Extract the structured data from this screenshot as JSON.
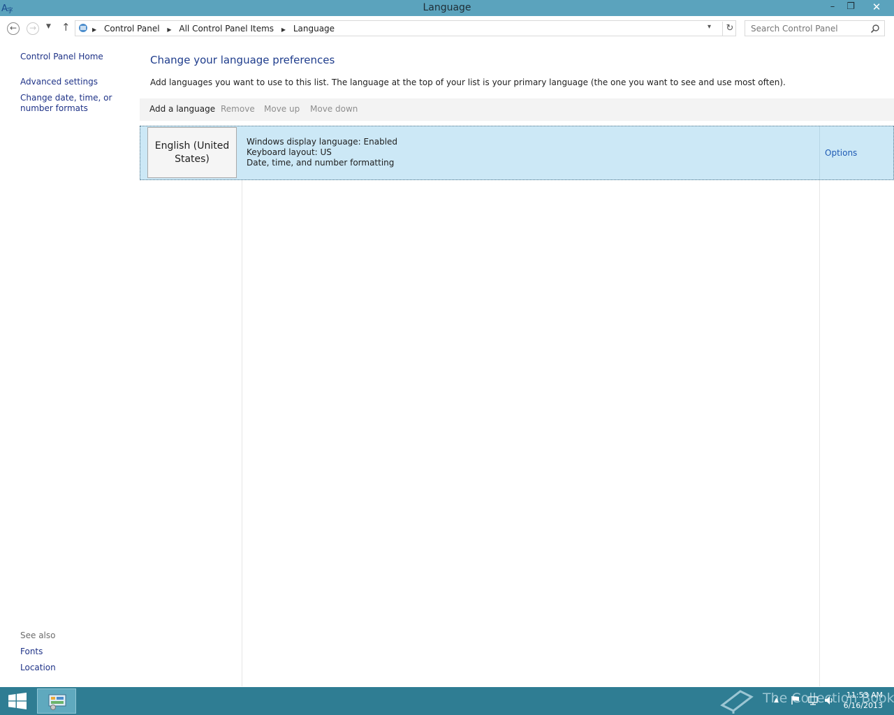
{
  "window": {
    "title": "Language",
    "minimize_glyph": "–",
    "restore_glyph": "❐",
    "close_glyph": "✕"
  },
  "nav": {
    "back_glyph": "←",
    "forward_glyph": "→",
    "recent_glyph": "▼",
    "up_glyph": "↑",
    "breadcrumbs": [
      "Control Panel",
      "All Control Panel Items",
      "Language"
    ],
    "separator_glyph": "▶",
    "dropdown_glyph": "▾",
    "refresh_glyph": "↻",
    "search_placeholder": "Search Control Panel"
  },
  "sidebar": {
    "home": "Control Panel Home",
    "advanced": "Advanced settings",
    "date_formats": "Change date, time, or number formats",
    "see_also_label": "See also",
    "fonts": "Fonts",
    "location": "Location"
  },
  "main": {
    "title": "Change your language preferences",
    "description": "Add languages you want to use to this list. The language at the top of your list is your primary language (the one you want to see and use most often).",
    "toolbar": {
      "add": "Add a language",
      "remove": "Remove",
      "move_up": "Move up",
      "move_down": "Move down"
    },
    "languages": [
      {
        "name": "English (United States)",
        "details": [
          "Windows display language: Enabled",
          "Keyboard layout: US",
          "Date, time, and number formatting"
        ],
        "options": "Options"
      }
    ]
  },
  "taskbar": {
    "watermark": "The Collection Book",
    "tray_up_glyph": "▲",
    "time": "11:53 AM",
    "date": "6/16/2013"
  },
  "colors": {
    "titlebar": "#5ba3bd",
    "taskbar": "#2f7d93",
    "selection": "#cce8f6",
    "link": "#1e3287"
  },
  "icons": [
    "app-language-icon",
    "close-icon",
    "search-icon",
    "refresh-icon",
    "windows-logo-icon",
    "control-panel-icon"
  ]
}
